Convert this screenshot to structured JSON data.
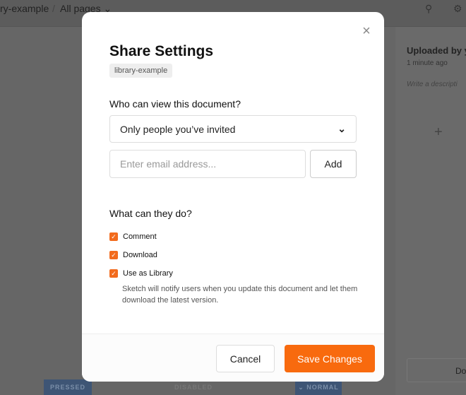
{
  "background": {
    "breadcrumb_doc": "ry-example",
    "breadcrumb_sep": "/",
    "breadcrumb_pages": "All pages",
    "uploaded_by": "Uploaded by y",
    "uploaded_time": "1 minute ago",
    "description_placeholder": "Write a descripti",
    "plus": "+",
    "download_label": "Do",
    "pressed": "PRESSED",
    "disabled": "DISABLED",
    "normal": "NORMAL"
  },
  "modal": {
    "title": "Share Settings",
    "tag": "library-example",
    "close": "×",
    "view_question": "Who can view this document?",
    "view_selected": "Only people you’ve invited",
    "email_placeholder": "Enter email address...",
    "add_label": "Add",
    "do_question": "What can they do?",
    "permissions": [
      {
        "label": "Comment",
        "checked": true
      },
      {
        "label": "Download",
        "checked": true
      },
      {
        "label": "Use as Library",
        "checked": true
      }
    ],
    "library_hint": "Sketch will notify users when you update this document and let them download the latest version.",
    "cancel_label": "Cancel",
    "save_label": "Save Changes"
  },
  "colors": {
    "accent": "#f86a0e",
    "overlay": "#666666"
  }
}
